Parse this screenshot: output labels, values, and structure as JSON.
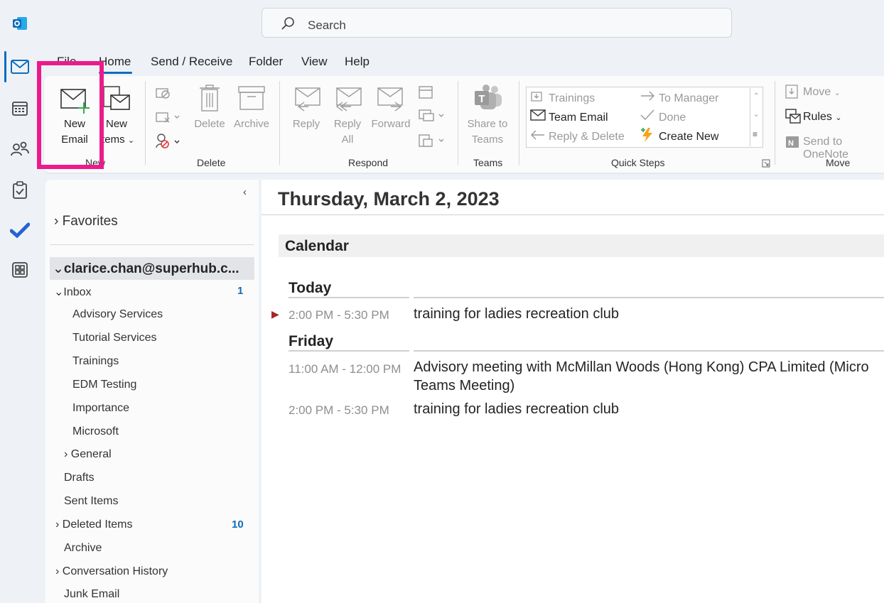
{
  "search": {
    "placeholder": "Search"
  },
  "menu": {
    "tabs": [
      "File",
      "Home",
      "Send / Receive",
      "Folder",
      "View",
      "Help"
    ],
    "active": "Home"
  },
  "ribbon": {
    "new_group": {
      "new_email": [
        "New",
        "Email"
      ],
      "new_items": [
        "New",
        "Items"
      ],
      "label": "New"
    },
    "delete_group": {
      "delete": "Delete",
      "archive": "Archive",
      "label": "Delete"
    },
    "respond_group": {
      "reply": "Reply",
      "reply_all": [
        "Reply",
        "All"
      ],
      "forward": "Forward",
      "label": "Respond"
    },
    "teams_group": {
      "share": [
        "Share to",
        "Teams"
      ],
      "label": "Teams"
    },
    "quick_steps": {
      "items": [
        "Trainings",
        "Team Email",
        "Reply & Delete",
        "To Manager",
        "Done",
        "Create New"
      ],
      "label": "Quick Steps"
    },
    "move_group": {
      "move": "Move",
      "rules": "Rules",
      "onenote": "Send to OneNote",
      "label": "Move"
    }
  },
  "folders": {
    "favorites": "Favorites",
    "account": "clarice.chan@superhub.c...",
    "inbox": {
      "label": "Inbox",
      "count": "1"
    },
    "subfolders": [
      "Advisory Services",
      "Tutorial Services",
      "Trainings",
      "EDM Testing",
      "Importance",
      "Microsoft"
    ],
    "general": "General",
    "drafts": "Drafts",
    "sent": "Sent Items",
    "deleted": {
      "label": "Deleted Items",
      "count": "10"
    },
    "archive": "Archive",
    "conversation": "Conversation History",
    "junk": "Junk Email"
  },
  "main": {
    "date": "Thursday, March 2, 2023",
    "calendar_label": "Calendar",
    "today": {
      "label": "Today",
      "events": [
        {
          "time": "2:00 PM - 5:30 PM",
          "subject": "training for ladies recreation club"
        }
      ]
    },
    "friday": {
      "label": "Friday",
      "events": [
        {
          "time": "11:00 AM - 12:00 PM",
          "subject": "Advisory meeting with McMillan Woods (Hong Kong) CPA Limited (Micro",
          "subject2": "Teams Meeting)"
        },
        {
          "time": "2:00 PM - 5:30 PM",
          "subject": "training for ladies recreation club"
        }
      ]
    }
  },
  "colors": {
    "accent": "#0f6cbd",
    "highlight": "#ec1b8c"
  }
}
